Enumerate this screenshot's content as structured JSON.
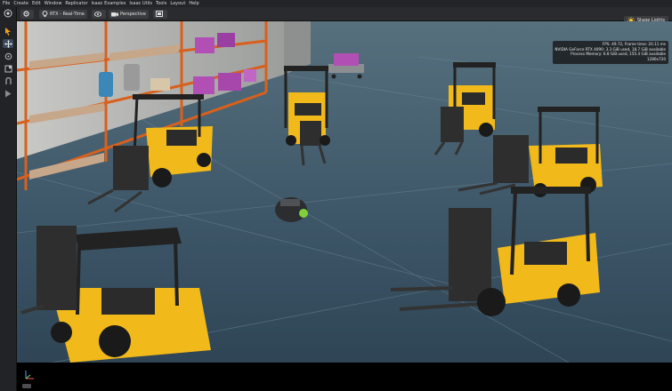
{
  "menu": [
    "File",
    "Create",
    "Edit",
    "Window",
    "Replicator",
    "Isaac Examples",
    "Isaac Utils",
    "Tools",
    "Layout",
    "Help"
  ],
  "toolbar": {
    "renderer_label": "RTX - Real-Time",
    "camera_label": "Perspective",
    "stage_lights_label": "Stage Lights"
  },
  "stats": {
    "fps_line": "FPS: 49.72, Frame time: 20.11 ms",
    "gpu_line": "NVIDIA GeForce RTX 4090: 3.3 GiB used, 18.7 GiB available",
    "memory_line": "Process Memory: 6.8 GiB used, 155.4 GiB available",
    "resolution_line": "1280x720"
  },
  "icons": {
    "top_left": "app-logo-icon",
    "tools": [
      "select-arrow-icon",
      "move-icon",
      "rotate-icon",
      "scale-icon",
      "snap-icon",
      "play-icon"
    ]
  },
  "colors": {
    "accent": "#f0b912",
    "floor": "#3c5466",
    "shelf": "#d9601c"
  }
}
